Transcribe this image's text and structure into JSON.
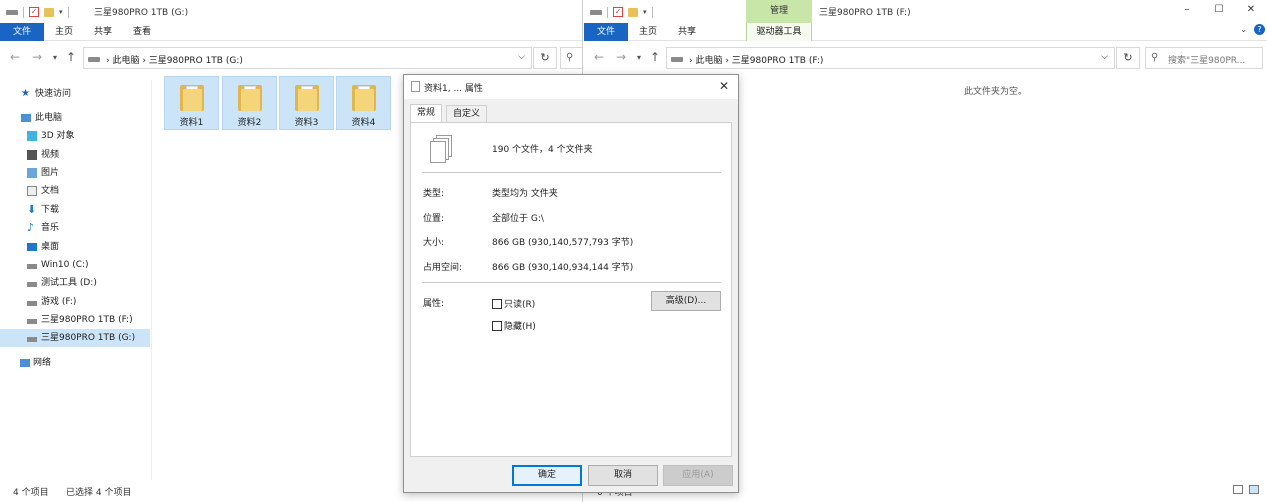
{
  "left_window": {
    "title": "三星980PRO 1TB (G:)",
    "tabs": [
      "文件",
      "主页",
      "共享",
      "查看"
    ],
    "address_path": "› 此电脑 › 三星980PRO 1TB (G:)",
    "nav_items": [
      {
        "label": "快速访问",
        "icon": "star-icon"
      },
      {
        "label": "此电脑",
        "icon": "computer-icon"
      },
      {
        "label": "3D 对象",
        "icon": "cube-icon"
      },
      {
        "label": "视频",
        "icon": "video-icon"
      },
      {
        "label": "图片",
        "icon": "picture-icon"
      },
      {
        "label": "文档",
        "icon": "document-icon"
      },
      {
        "label": "下载",
        "icon": "download-icon"
      },
      {
        "label": "音乐",
        "icon": "music-icon"
      },
      {
        "label": "桌面",
        "icon": "desktop-icon"
      },
      {
        "label": "Win10 (C:)",
        "icon": "windows-drive-icon"
      },
      {
        "label": "测试工具 (D:)",
        "icon": "drive-icon"
      },
      {
        "label": "游戏 (F:)",
        "icon": "drive-icon"
      },
      {
        "label": "三星980PRO 1TB (F:)",
        "icon": "drive-icon"
      },
      {
        "label": "三星980PRO 1TB (G:)",
        "icon": "drive-icon"
      },
      {
        "label": "网络",
        "icon": "network-icon"
      }
    ],
    "folders": [
      "资料1",
      "资料2",
      "资料3",
      "资料4"
    ],
    "status_count": "4 个项目",
    "status_selected": "已选择 4 个项目"
  },
  "right_window": {
    "title": "三星980PRO 1TB (F:)",
    "context_header": "管理",
    "tabs": [
      "文件",
      "主页",
      "共享"
    ],
    "context_tab": "驱动器工具",
    "address_path": "› 此电脑 › 三星980PRO 1TB (F:)",
    "search_placeholder": "搜索\"三星980PR...",
    "empty_message": "此文件夹为空。",
    "status_count": "0 个项目"
  },
  "dialog": {
    "title": "资料1, ... 属性",
    "tabs": [
      "常规",
      "自定义"
    ],
    "summary": "190 个文件，4 个文件夹",
    "rows": [
      {
        "label": "类型:",
        "value": "类型均为 文件夹"
      },
      {
        "label": "位置:",
        "value": "全部位于 G:\\"
      },
      {
        "label": "大小:",
        "value": "866 GB (930,140,577,793 字节)"
      },
      {
        "label": "占用空间:",
        "value": "866 GB (930,140,934,144 字节)"
      }
    ],
    "attributes_label": "属性:",
    "readonly_label": "只读(R)",
    "hidden_label": "隐藏(H)",
    "advanced_button": "高级(D)...",
    "ok_button": "确定",
    "cancel_button": "取消",
    "apply_button": "应用(A)"
  },
  "colors": {
    "file_tab": "#1a64c3",
    "selection": "#cce4f7",
    "context_tab": "#c8e6a8",
    "folder": "#f5d57c"
  }
}
